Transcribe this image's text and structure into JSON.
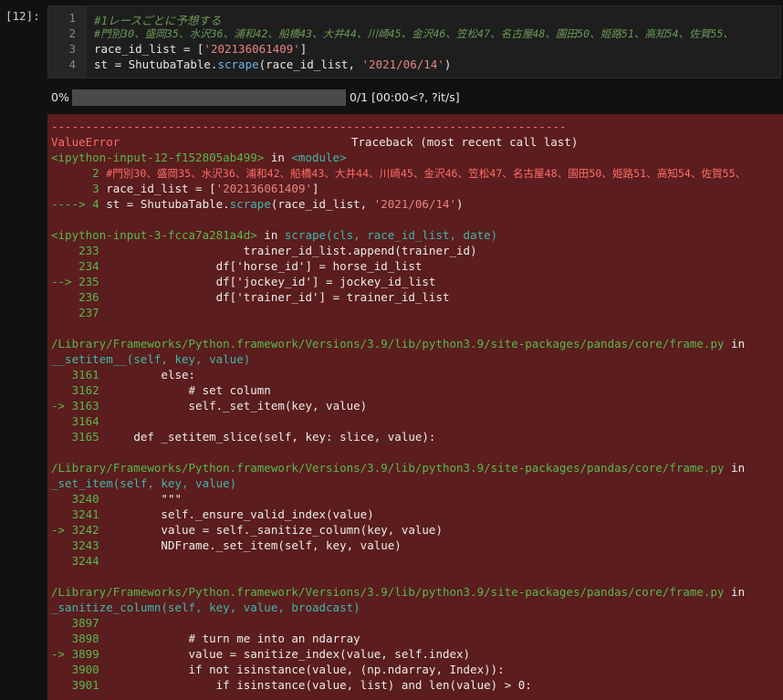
{
  "prompt": "[12]:",
  "input_cell": {
    "line_numbers": [
      "1",
      "2",
      "3",
      "4"
    ],
    "line1_comment": "#1レースごとに予想する",
    "line2_comment": "#門別30、盛岡35、水沢36、浦和42、船橋43、大井44、川崎45、金沢46、笠松47、名古屋48、園田50、姫路51、高知54、佐賀55、",
    "line3_var": "race_id_list = [",
    "line3_str": "'202136061409'",
    "line3_end": "]",
    "line4_a": "st = ShutubaTable.",
    "line4_fn": "scrape",
    "line4_b": "(race_id_list, ",
    "line4_str": "'2021/06/14'",
    "line4_c": ")"
  },
  "progress": {
    "percent_label": "0%",
    "fraction": 0,
    "status": "0/1 [00:00<?, ?it/s]",
    "fill_color": "#2e7bd6"
  },
  "traceback": {
    "separator": "---------------------------------------------------------------------------",
    "error_name": "ValueError",
    "header_right": "Traceback (most recent call last)",
    "frame1": {
      "file": "<ipython-input-12-f152805ab499>",
      "in_word": " in ",
      "where": "<module>",
      "l2_no": "      2 ",
      "l2_text": "#門別30、盛岡35、水沢36、浦和42、船橋43、大井44、川崎45、金沢46、笠松47、名古屋48、園田50、姫路51、高知54、佐賀55、",
      "l3_no": "      3 ",
      "l3_text": "race_id_list = [",
      "l3_str": "'202136061409'",
      "l3_end": "]",
      "l4_no": "----> 4 ",
      "l4_a": "st = ShutubaTable.",
      "l4_fn": "scrape",
      "l4_b": "(race_id_list, ",
      "l4_str": "'2021/06/14'",
      "l4_c": ")"
    },
    "frame2": {
      "file": "<ipython-input-3-fcca7a281a4d>",
      "in_word": " in ",
      "where": "scrape(cls, race_id_list, date)",
      "lines": [
        {
          "no": "    233 ",
          "code": "                    trainer_id_list.append(trainer_id)"
        },
        {
          "no": "    234 ",
          "code": "                df['horse_id'] = horse_id_list"
        },
        {
          "no": "--> 235 ",
          "code": "                df['jockey_id'] = jockey_id_list"
        },
        {
          "no": "    236 ",
          "code": "                df['trainer_id'] = trainer_id_list"
        },
        {
          "no": "    237 ",
          "code": ""
        }
      ]
    },
    "frame3": {
      "path": "/Library/Frameworks/Python.framework/Versions/3.9/lib/python3.9/site-packages/pandas/core/frame.py",
      "in_word": " in",
      "func": "__setitem__(self, key, value)",
      "lines": [
        {
          "no": "   3161 ",
          "code": "        else:"
        },
        {
          "no": "   3162 ",
          "code": "            # set column"
        },
        {
          "no": "-> 3163 ",
          "code": "            self._set_item(key, value)"
        },
        {
          "no": "   3164 ",
          "code": ""
        },
        {
          "no": "   3165 ",
          "code": "    def _setitem_slice(self, key: slice, value):"
        }
      ]
    },
    "frame4": {
      "path": "/Library/Frameworks/Python.framework/Versions/3.9/lib/python3.9/site-packages/pandas/core/frame.py",
      "in_word": " in",
      "func": "_set_item(self, key, value)",
      "lines": [
        {
          "no": "   3240 ",
          "code": "        \"\"\""
        },
        {
          "no": "   3241 ",
          "code": "        self._ensure_valid_index(value)"
        },
        {
          "no": "-> 3242 ",
          "code": "        value = self._sanitize_column(key, value)"
        },
        {
          "no": "   3243 ",
          "code": "        NDFrame._set_item(self, key, value)"
        },
        {
          "no": "   3244 ",
          "code": ""
        }
      ]
    },
    "frame5": {
      "path": "/Library/Frameworks/Python.framework/Versions/3.9/lib/python3.9/site-packages/pandas/core/frame.py",
      "in_word": " in",
      "func": "_sanitize_column(self, key, value, broadcast)",
      "lines": [
        {
          "no": "   3897 ",
          "code": ""
        },
        {
          "no": "   3898 ",
          "code": "            # turn me into an ndarray"
        },
        {
          "no": "-> 3899 ",
          "code": "            value = sanitize_index(value, self.index)"
        },
        {
          "no": "   3900 ",
          "code": "            if not isinstance(value, (np.ndarray, Index)):"
        },
        {
          "no": "   3901 ",
          "code": "                if isinstance(value, list) and len(value) > 0:"
        }
      ]
    }
  }
}
